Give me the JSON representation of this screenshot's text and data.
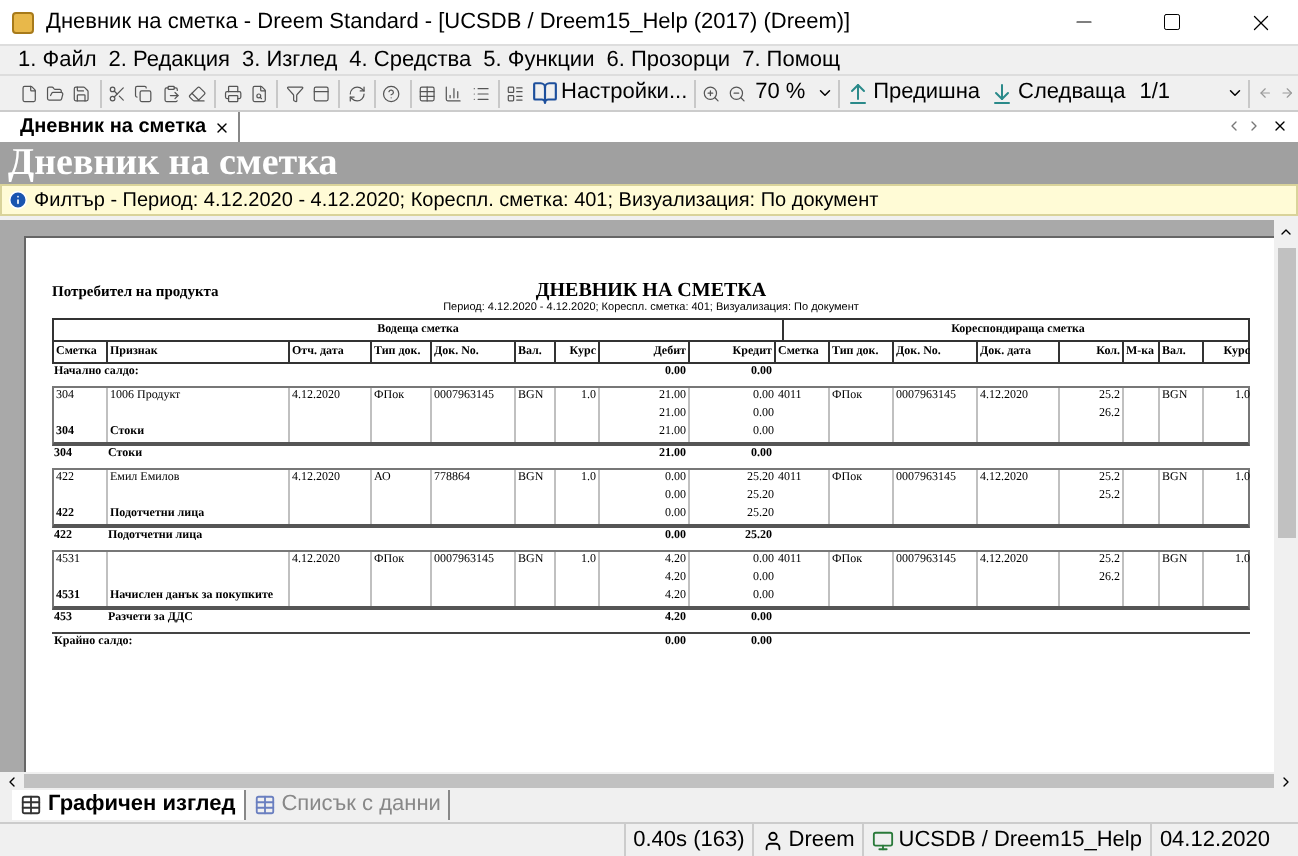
{
  "window": {
    "title": "Дневник на сметка - Dreem Standard - [UCSDB / Dreem15_Help (2017) (Dreem)]"
  },
  "menu": [
    "1. Файл",
    "2. Редакция",
    "3. Изглед",
    "4. Средства",
    "5. Функции",
    "6. Прозорци",
    "7. Помощ"
  ],
  "toolbar": {
    "settings": "Настройки...",
    "zoom": "70 %",
    "previous": "Предишна",
    "next": "Следваща",
    "page": "1/1"
  },
  "document_tabs": [
    {
      "label": "Дневник на сметка",
      "selected": true
    }
  ],
  "header": {
    "title": "Дневник на сметка"
  },
  "filter": "Филтър - Период: 4.12.2020 - 4.12.2020; Кореспл. сметка: 401; Визуализация: По документ",
  "report": {
    "left_title": "Потребител на продукта",
    "title": "ДНЕВНИК НА СМЕТКА",
    "subtitle": "Период: 4.12.2020 - 4.12.2020; Кореспл. сметка: 401; Визуализация: По документ",
    "group_headers": [
      "Водеща сметка",
      "Кореспондираща сметка"
    ],
    "columns": [
      "Сметка",
      "Признак",
      "Отч. дата",
      "Тип док.",
      "Док. No.",
      "Вал.",
      "Курс",
      "Дебит",
      "Кредит",
      "Сметка",
      "Тип док.",
      "Док. No.",
      "Док. дата",
      "Кол.",
      "М-ка",
      "Вал.",
      "Курс"
    ],
    "opening": {
      "label": "Начално салдо:",
      "debit": "0.00",
      "credit": "0.00"
    },
    "groups": [
      {
        "lines": [
          {
            "account": "304",
            "name": "1006 Продукт",
            "date": "4.12.2020",
            "doc_type": "ФПок",
            "doc_no": "0007963145",
            "currency": "BGN",
            "rate": "1.0",
            "debit": "21.00",
            "credit": "0.00",
            "c_account": "4011",
            "c_doc_type": "ФПок",
            "c_doc_no": "0007963145",
            "c_doc_date": "4.12.2020",
            "qty": "25.2",
            "c_currency": "BGN",
            "c_rate": "1.0"
          },
          {
            "debit": "21.00",
            "credit": "0.00",
            "qty": "26.2"
          },
          {
            "account": "304",
            "name": "Стоки",
            "debit": "21.00",
            "credit": "0.00"
          }
        ],
        "subtotal": {
          "account": "304",
          "name": "Стоки",
          "debit": "21.00",
          "credit": "0.00"
        }
      },
      {
        "lines": [
          {
            "account": "422",
            "name": "Емил Емилов",
            "date": "4.12.2020",
            "doc_type": "АО",
            "doc_no": "778864",
            "currency": "BGN",
            "rate": "1.0",
            "debit": "0.00",
            "credit": "25.20",
            "c_account": "4011",
            "c_doc_type": "ФПок",
            "c_doc_no": "0007963145",
            "c_doc_date": "4.12.2020",
            "qty": "25.2",
            "c_currency": "BGN",
            "c_rate": "1.0"
          },
          {
            "debit": "0.00",
            "credit": "25.20",
            "qty": "25.2"
          },
          {
            "account": "422",
            "name": "Подотчетни лица",
            "debit": "0.00",
            "credit": "25.20"
          }
        ],
        "subtotal": {
          "account": "422",
          "name": "Подотчетни лица",
          "debit": "0.00",
          "credit": "25.20"
        }
      },
      {
        "lines": [
          {
            "account": "4531",
            "date": "4.12.2020",
            "doc_type": "ФПок",
            "doc_no": "0007963145",
            "currency": "BGN",
            "rate": "1.0",
            "debit": "4.20",
            "credit": "0.00",
            "c_account": "4011",
            "c_doc_type": "ФПок",
            "c_doc_no": "0007963145",
            "c_doc_date": "4.12.2020",
            "qty": "25.2",
            "c_currency": "BGN",
            "c_rate": "1.0"
          },
          {
            "debit": "4.20",
            "credit": "0.00",
            "qty": "26.2"
          },
          {
            "account": "4531",
            "name": "Начислен данък за покупките",
            "debit": "4.20",
            "credit": "0.00"
          }
        ],
        "subtotal": {
          "account": "453",
          "name": "Разчети за ДДС",
          "debit": "4.20",
          "credit": "0.00"
        }
      }
    ],
    "closing": {
      "label": "Крайно салдо:",
      "debit": "0.00",
      "credit": "0.00"
    }
  },
  "view_tabs": [
    {
      "label": "Графичен изглед",
      "selected": true
    },
    {
      "label": "Списък с данни",
      "selected": false
    }
  ],
  "status_bar": [
    "0.40s (163)",
    "Dreem",
    "UCSDB / Dreem15_Help",
    "04.12.2020"
  ]
}
